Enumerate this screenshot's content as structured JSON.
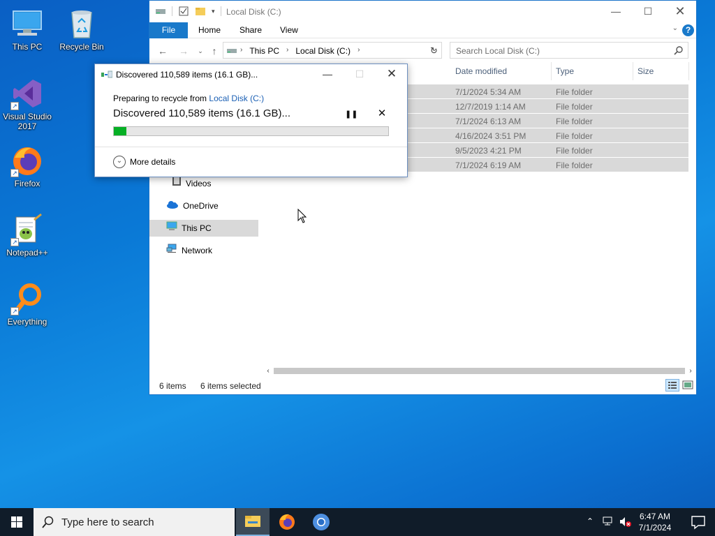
{
  "desktop": {
    "icons": [
      {
        "label": "This PC"
      },
      {
        "label": "Recycle Bin"
      },
      {
        "label": "Visual Studio 2017"
      },
      {
        "label": "Firefox"
      },
      {
        "label": "Notepad++"
      },
      {
        "label": "Everything"
      }
    ]
  },
  "explorer": {
    "title": "Local Disk (C:)",
    "ribbon_tabs": [
      "File",
      "Home",
      "Share",
      "View"
    ],
    "breadcrumbs": [
      "This PC",
      "Local Disk (C:)"
    ],
    "search_placeholder": "Search Local Disk (C:)",
    "columns": [
      "Date modified",
      "Type",
      "Size"
    ],
    "rows": [
      {
        "date": "7/1/2024 5:34 AM",
        "type": "File folder"
      },
      {
        "date": "12/7/2019 1:14 AM",
        "type": "File folder"
      },
      {
        "date": "7/1/2024 6:13 AM",
        "type": "File folder"
      },
      {
        "date": "4/16/2024 3:51 PM",
        "type": "File folder"
      },
      {
        "date": "9/5/2023 4:21 PM",
        "type": "File folder"
      },
      {
        "date": "7/1/2024 6:19 AM",
        "type": "File folder"
      }
    ],
    "nav": [
      "Videos",
      "OneDrive",
      "This PC",
      "Network"
    ],
    "status": {
      "items": "6 items",
      "selected": "6 items selected"
    }
  },
  "dialog": {
    "title": "Discovered 110,589 items (16.1 GB)...",
    "from_prefix": "Preparing to recycle from ",
    "from_link": "Local Disk (C:)",
    "main_text": "Discovered 110,589 items (16.1 GB)...",
    "progress_percent": 4.5,
    "more_details": "More details"
  },
  "taskbar": {
    "search_placeholder": "Type here to search",
    "time": "6:47 AM",
    "date": "7/1/2024"
  },
  "colors": {
    "accent": "#1979ca",
    "progress": "#06b025",
    "taskbar": "#101c29"
  }
}
